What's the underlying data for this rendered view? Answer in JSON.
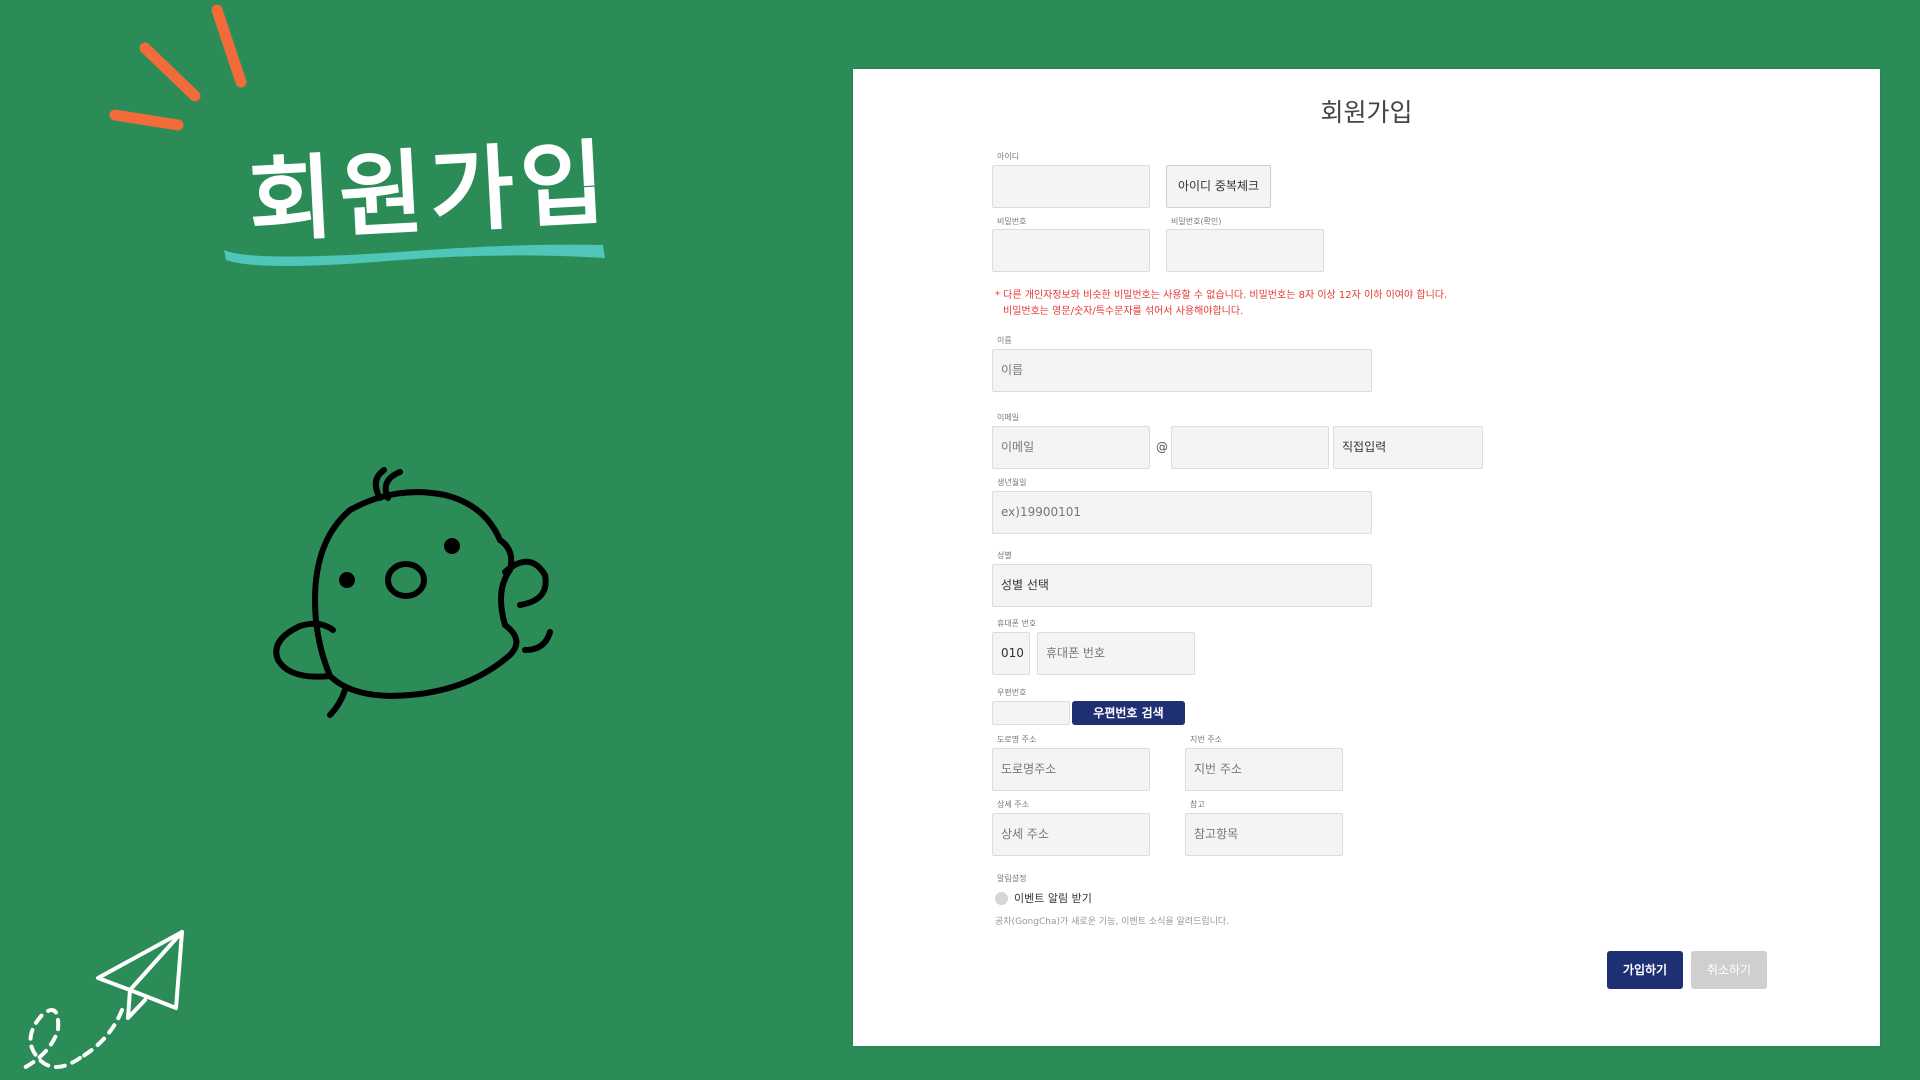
{
  "hero": {
    "title": "회원가입"
  },
  "colors": {
    "background": "#2b8c57",
    "accent_orange": "#f26b3a",
    "underline_teal": "#4fc6b8",
    "primary_button": "#1e2f73"
  },
  "icons": [
    "burst-lines-icon",
    "chick-doodle-icon",
    "paper-plane-icon"
  ],
  "form": {
    "title": "회원가입",
    "id": {
      "label": "아이디",
      "value": "",
      "check_button": "아이디 중복체크"
    },
    "password": {
      "label": "비밀번호",
      "value": ""
    },
    "password_confirm": {
      "label": "비밀번호(확인)",
      "value": ""
    },
    "password_rule_line1": "* 다른 개인자정보와 비슷한 비밀번호는 사용할 수 없습니다. 비밀번호는 8자 이상 12자 이하 이여야 합니다.",
    "password_rule_line2": "비밀번호는 영문/숫자/특수문자를 섞어서 사용해야합니다.",
    "name": {
      "label": "이름",
      "placeholder": "이름"
    },
    "email": {
      "label": "이메일",
      "placeholder": "이메일",
      "at": "@",
      "domain_value": "",
      "domain_select": "직접입력"
    },
    "birth": {
      "label": "생년월일",
      "placeholder": "ex)19900101"
    },
    "gender": {
      "label": "성별",
      "select": "성별 선택"
    },
    "phone": {
      "label": "휴대폰 번호",
      "prefix": "010",
      "placeholder": "휴대폰 번호"
    },
    "zipcode": {
      "label": "우편번호",
      "value": "",
      "search_button": "우편번호 검색"
    },
    "road_address": {
      "label": "도로명 주소",
      "placeholder": "도로명주소"
    },
    "jibun_address": {
      "label": "지번 주소",
      "placeholder": "지번 주소"
    },
    "detail_address": {
      "label": "상세 주소",
      "placeholder": "상세 주소"
    },
    "reference": {
      "label": "참고",
      "placeholder": "참고항목"
    },
    "notify": {
      "label": "알림설정",
      "option": "이벤트 알림 받기",
      "help": "공차(GongCha)가 새로운 기능, 이벤트 소식을 알려드립니다."
    },
    "submit_button": "가입하기",
    "cancel_button": "취소하기"
  }
}
